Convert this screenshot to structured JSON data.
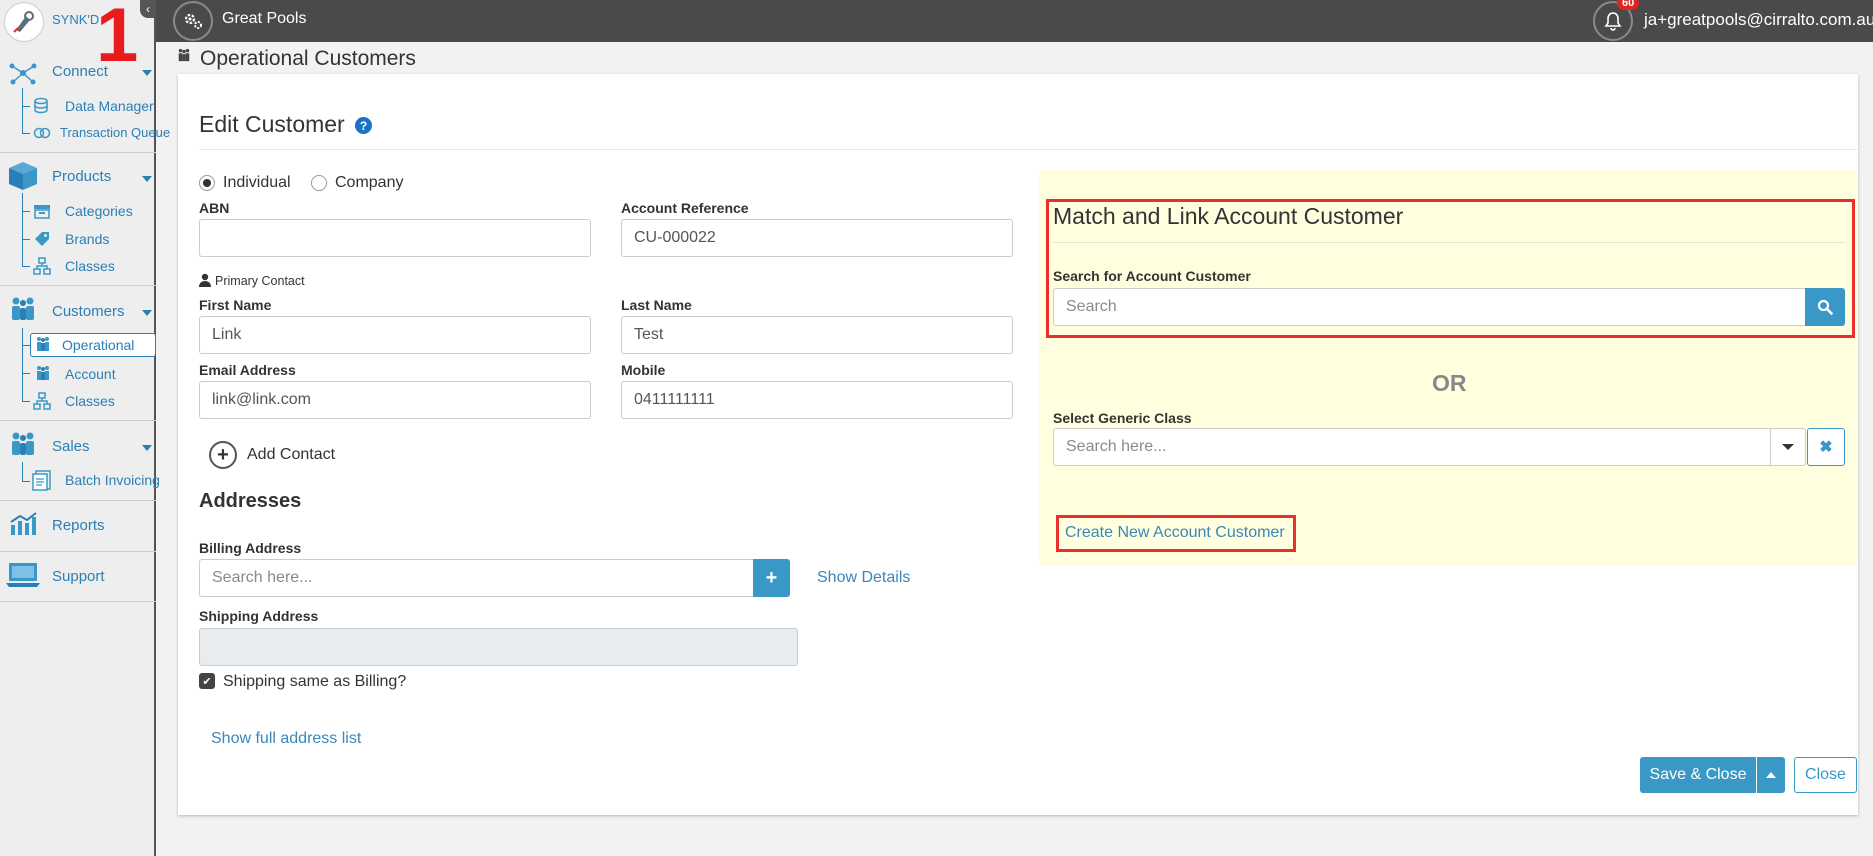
{
  "header": {
    "app_name": "Great Pools",
    "notification_count": "60",
    "user_email": "ja+greatpools@cirralto.com.au"
  },
  "sidebar": {
    "brand": "SYNK'D",
    "annotation_number": "1",
    "sections": {
      "connect": {
        "label": "Connect",
        "items": [
          "Data Manager",
          "Transaction Queue"
        ]
      },
      "products": {
        "label": "Products",
        "items": [
          "Categories",
          "Brands",
          "Classes"
        ]
      },
      "customers": {
        "label": "Customers",
        "items": [
          "Operational",
          "Account",
          "Classes"
        ]
      },
      "sales": {
        "label": "Sales",
        "items": [
          "Batch Invoicing"
        ]
      },
      "reports": {
        "label": "Reports"
      },
      "support": {
        "label": "Support"
      }
    },
    "active_item": "Operational"
  },
  "page": {
    "title": "Operational Customers"
  },
  "form": {
    "title": "Edit Customer",
    "type_options": [
      "Individual",
      "Company"
    ],
    "selected_type": "Individual",
    "abn_label": "ABN",
    "abn_value": "",
    "account_reference_label": "Account Reference",
    "account_reference_value": "CU-000022",
    "primary_contact_label": "Primary Contact",
    "first_name_label": "First Name",
    "first_name_value": "Link",
    "last_name_label": "Last Name",
    "last_name_value": "Test",
    "email_label": "Email Address",
    "email_value": "link@link.com",
    "mobile_label": "Mobile",
    "mobile_value": "0411111111",
    "add_contact_label": "Add Contact",
    "addresses_heading": "Addresses",
    "billing_label": "Billing Address",
    "billing_placeholder": "Search here...",
    "show_details_label": "Show Details",
    "shipping_label": "Shipping Address",
    "shipping_same_label": "Shipping same as Billing?",
    "shipping_same_checked": true,
    "show_full_address_label": "Show full address list"
  },
  "match": {
    "title": "Match and Link Account Customer",
    "search_label": "Search for Account Customer",
    "search_placeholder": "Search",
    "or_label": "OR",
    "generic_class_label": "Select Generic Class",
    "generic_class_placeholder": "Search here...",
    "create_new_label": "Create New Account Customer"
  },
  "footer": {
    "save_close_label": "Save & Close",
    "close_label": "Close"
  },
  "colors": {
    "accent": "#3a98c6",
    "sidebar_text": "#2a7fb5",
    "highlight_border": "#e8302b",
    "match_panel_bg": "#ffffe0",
    "topbar": "#4a4a4a"
  }
}
